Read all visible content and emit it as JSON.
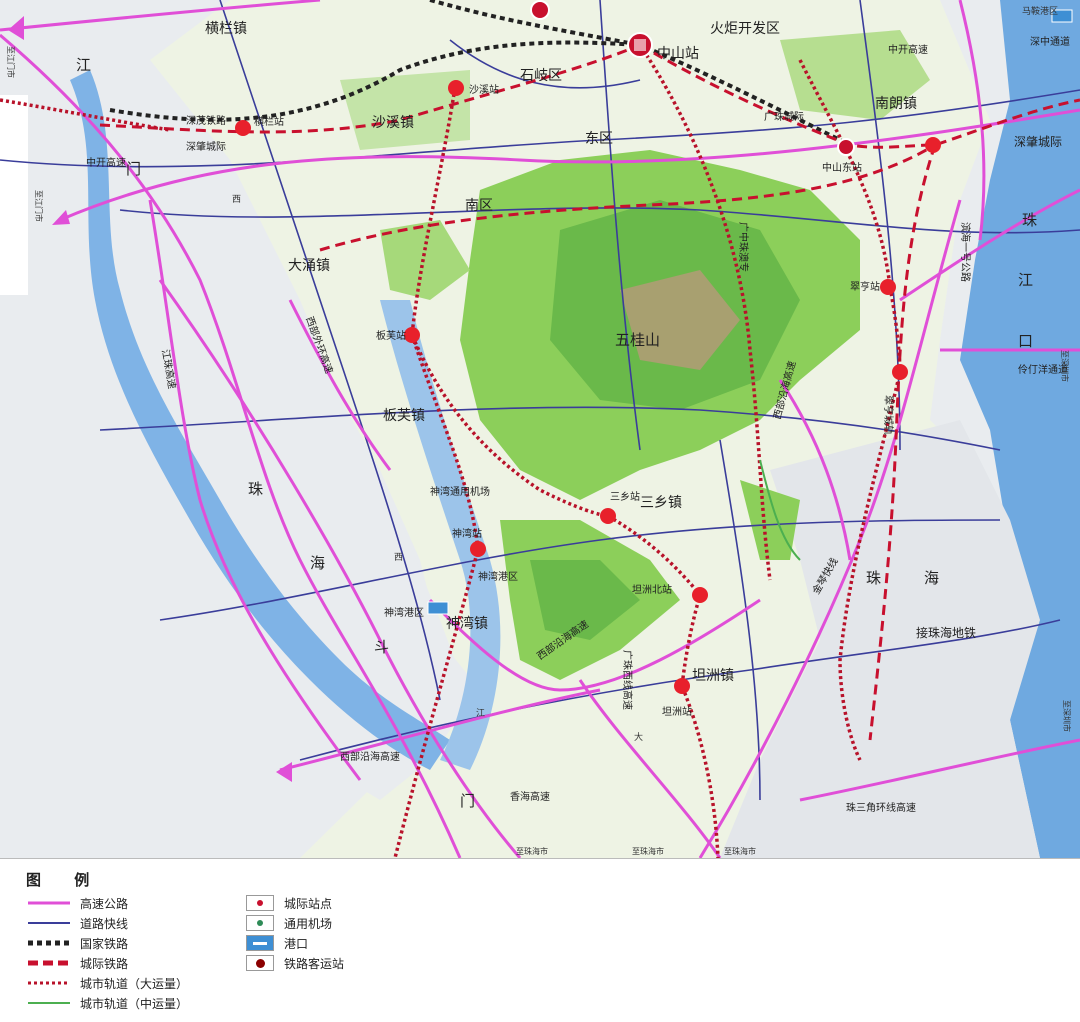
{
  "map": {
    "places": {
      "henglan": "横栏镇",
      "shaxi": "沙溪镇",
      "shiqi": "石岐区",
      "dongqu": "东区",
      "nanqu": "南区",
      "huoju": "火炬开发区",
      "nanlang": "南朗镇",
      "dachong": "大涌镇",
      "wuguishan": "五桂山",
      "banfu": "板芙镇",
      "sanxiang": "三乡镇",
      "shenwan": "神湾镇",
      "tanzhou": "坦洲镇"
    },
    "stations": {
      "zhongshan": "中山站",
      "hengqi": "横栏站",
      "shaxi_station": "沙溪站",
      "zhongshan_north": "中山东站",
      "cuiheng": "翠亨站",
      "banfu_station": "板芙站",
      "sanxiang_station": "三乡站",
      "shenwan_station": "神湾站",
      "tanzhou_north": "坦洲北站",
      "tanzhou_station": "坦洲站"
    },
    "lines": {
      "shenmao": "深茂铁路",
      "shenzhao_left": "深肇城际",
      "shenzhao_right": "深肇城际",
      "guangzhu": "广珠城际",
      "guangzhong_zhuao": "广中珠澳专",
      "zhongkai": "中开高速",
      "zhongkai_right": "中开高速",
      "shenzhong": "深中通道",
      "binhai": "滨海一号公路",
      "lingding": "伶仃洋通道",
      "xibu_waihuan": "西部外环高速",
      "jiangzhu": "江珠高速",
      "xibu_yanhai_mid": "西部沿海高速",
      "xibu_yanhai_bottom": "西部沿海高速",
      "xibu_yanhai_right": "西部沿海高速",
      "guangzhu_xixian": "广珠西线高速",
      "xiangzhu": "香海高速",
      "jinhai": "金琴快线",
      "zhuyuan_huanxian": "珠三角环线高速",
      "jie_zhuhai_metro": "接珠海地铁",
      "ping_ning": "翠亨城轨",
      "shenwan_airport": "神湾通用机场",
      "shenwan_port": "神湾港区",
      "shenwan_port2": "神湾港区"
    },
    "water": {
      "zhujiangkou_1": "珠",
      "zhujiangkou_2": "江",
      "zhujiangkou_3": "口",
      "modaomen_1": "珠",
      "modaomen_2": "海",
      "modaomen_3": "斗",
      "modaomen_4": "门",
      "zhuhai_sea_1": "珠",
      "zhuhai_sea_2": "海",
      "jiangmen_1": "江",
      "jiangmen_2": "门",
      "xi": "西",
      "jiang_small": "江",
      "da": "大",
      "xi2": "西"
    },
    "edges": {
      "to_jiangmen": "至江门市",
      "to_jiangmen2": "至江门市",
      "to_zhuhai_1": "至珠海市",
      "to_zhuhai_2": "至珠海市",
      "to_zhuhai_3": "至珠海市",
      "to_shenzhen": "至深圳市",
      "to_shenzhen2": "至深圳市",
      "mazhou_port": "马鞍港区"
    },
    "colors": {
      "land": "#eef3e4",
      "water": "#7fb3e6",
      "sea": "#6fa9e0",
      "mountain": "#8ccf5a",
      "highway": "#e04fd7",
      "expressway": "#3a3d9a",
      "intercity": "#c8102e",
      "metro": "#b8122a",
      "rail": "#222222"
    }
  },
  "legend": {
    "title": "图 例",
    "items": [
      {
        "key": "highway",
        "label": "高速公路"
      },
      {
        "key": "expressway",
        "label": "道路快线"
      },
      {
        "key": "national_rail",
        "label": "国家铁路"
      },
      {
        "key": "intercity_rail",
        "label": "城际铁路"
      },
      {
        "key": "metro_large",
        "label": "城市轨道（大运量）"
      },
      {
        "key": "metro_medium",
        "label": "城市轨道（中运量）"
      },
      {
        "key": "intercity_station",
        "label": "城际站点"
      },
      {
        "key": "airport",
        "label": "通用机场"
      },
      {
        "key": "port",
        "label": "港口"
      },
      {
        "key": "rail_station",
        "label": "铁路客运站"
      }
    ]
  }
}
